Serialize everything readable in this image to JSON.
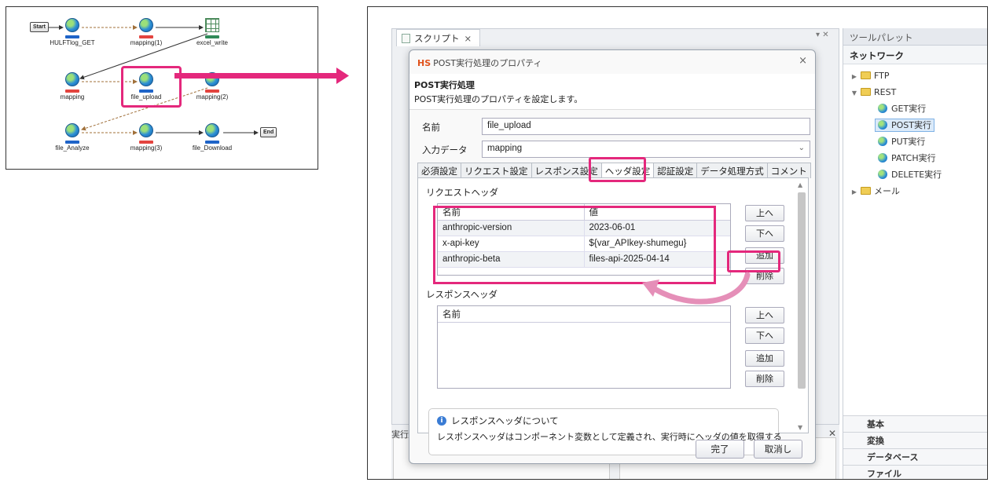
{
  "flow": {
    "start": "Start",
    "end": "End",
    "nodes": {
      "hulft_get": "HULFTlog_GET",
      "mapping1": "mapping(1)",
      "excel_write": "excel_write",
      "mapping": "mapping",
      "file_upload": "file_upload",
      "mapping2": "mapping(2)",
      "file_analyze": "file_Analyze",
      "mapping3": "mapping(3)",
      "file_download": "file_Download"
    }
  },
  "editor": {
    "tab_label": "スクリプト",
    "tab_close": "×",
    "controls": "▾ ✕",
    "run_label": "実行",
    "bottom_close": "✕"
  },
  "palette": {
    "title": "ツールパレット",
    "section": "ネットワーク",
    "tree": {
      "ftp": "FTP",
      "rest": "REST",
      "get": "GET実行",
      "post": "POST実行",
      "put": "PUT実行",
      "patch": "PATCH実行",
      "delete": "DELETE実行",
      "mail": "メール"
    },
    "categories": [
      "基本",
      "変換",
      "データベース",
      "ファイル"
    ]
  },
  "dialog": {
    "brand": "HS",
    "title": "POST実行処理のプロパティ",
    "close": "×",
    "heading": "POST実行処理",
    "description": "POST実行処理のプロパティを設定します。",
    "name_label": "名前",
    "name_value": "file_upload",
    "input_label": "入力データ",
    "input_value": "mapping",
    "tabs": [
      "必須設定",
      "リクエスト設定",
      "レスポンス設定",
      "ヘッダ設定",
      "認証設定",
      "データ処理方式",
      "コメント"
    ],
    "request_headers": {
      "title": "リクエストヘッダ",
      "col_name": "名前",
      "col_value": "値",
      "rows": [
        {
          "name": "anthropic-version",
          "value": "2023-06-01"
        },
        {
          "name": "x-api-key",
          "value": "${var_APIkey-shumegu}"
        },
        {
          "name": "anthropic-beta",
          "value": "files-api-2025-04-14"
        }
      ]
    },
    "response_headers": {
      "title": "レスポンスヘッダ",
      "col_name": "名前"
    },
    "buttons": {
      "up": "上へ",
      "down": "下へ",
      "add": "追加",
      "remove": "削除"
    },
    "note_title": "レスポンスヘッダについて",
    "note_body": "レスポンスヘッダはコンポーネント変数として定義され、実行時にヘッダの値を取得する",
    "ok": "完了",
    "cancel": "取消し"
  },
  "colors": {
    "highlight": "#e4287c",
    "rest_tag": "#1f64c8",
    "mapping_tag": "#e3443f"
  }
}
